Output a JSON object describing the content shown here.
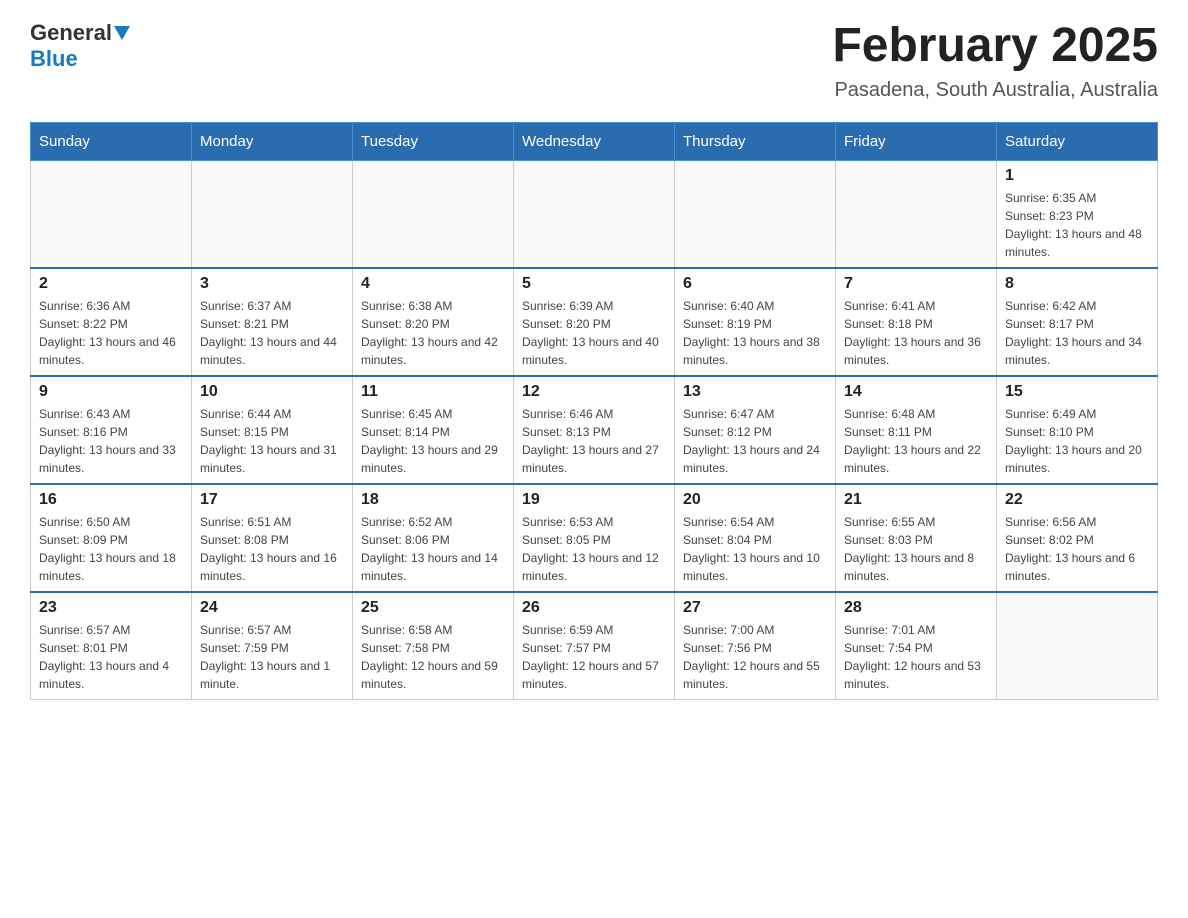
{
  "header": {
    "logo_general": "General",
    "logo_blue": "Blue",
    "title": "February 2025",
    "subtitle": "Pasadena, South Australia, Australia"
  },
  "days_of_week": [
    "Sunday",
    "Monday",
    "Tuesday",
    "Wednesday",
    "Thursday",
    "Friday",
    "Saturday"
  ],
  "weeks": [
    [
      {
        "day": "",
        "info": ""
      },
      {
        "day": "",
        "info": ""
      },
      {
        "day": "",
        "info": ""
      },
      {
        "day": "",
        "info": ""
      },
      {
        "day": "",
        "info": ""
      },
      {
        "day": "",
        "info": ""
      },
      {
        "day": "1",
        "info": "Sunrise: 6:35 AM\nSunset: 8:23 PM\nDaylight: 13 hours and 48 minutes."
      }
    ],
    [
      {
        "day": "2",
        "info": "Sunrise: 6:36 AM\nSunset: 8:22 PM\nDaylight: 13 hours and 46 minutes."
      },
      {
        "day": "3",
        "info": "Sunrise: 6:37 AM\nSunset: 8:21 PM\nDaylight: 13 hours and 44 minutes."
      },
      {
        "day": "4",
        "info": "Sunrise: 6:38 AM\nSunset: 8:20 PM\nDaylight: 13 hours and 42 minutes."
      },
      {
        "day": "5",
        "info": "Sunrise: 6:39 AM\nSunset: 8:20 PM\nDaylight: 13 hours and 40 minutes."
      },
      {
        "day": "6",
        "info": "Sunrise: 6:40 AM\nSunset: 8:19 PM\nDaylight: 13 hours and 38 minutes."
      },
      {
        "day": "7",
        "info": "Sunrise: 6:41 AM\nSunset: 8:18 PM\nDaylight: 13 hours and 36 minutes."
      },
      {
        "day": "8",
        "info": "Sunrise: 6:42 AM\nSunset: 8:17 PM\nDaylight: 13 hours and 34 minutes."
      }
    ],
    [
      {
        "day": "9",
        "info": "Sunrise: 6:43 AM\nSunset: 8:16 PM\nDaylight: 13 hours and 33 minutes."
      },
      {
        "day": "10",
        "info": "Sunrise: 6:44 AM\nSunset: 8:15 PM\nDaylight: 13 hours and 31 minutes."
      },
      {
        "day": "11",
        "info": "Sunrise: 6:45 AM\nSunset: 8:14 PM\nDaylight: 13 hours and 29 minutes."
      },
      {
        "day": "12",
        "info": "Sunrise: 6:46 AM\nSunset: 8:13 PM\nDaylight: 13 hours and 27 minutes."
      },
      {
        "day": "13",
        "info": "Sunrise: 6:47 AM\nSunset: 8:12 PM\nDaylight: 13 hours and 24 minutes."
      },
      {
        "day": "14",
        "info": "Sunrise: 6:48 AM\nSunset: 8:11 PM\nDaylight: 13 hours and 22 minutes."
      },
      {
        "day": "15",
        "info": "Sunrise: 6:49 AM\nSunset: 8:10 PM\nDaylight: 13 hours and 20 minutes."
      }
    ],
    [
      {
        "day": "16",
        "info": "Sunrise: 6:50 AM\nSunset: 8:09 PM\nDaylight: 13 hours and 18 minutes."
      },
      {
        "day": "17",
        "info": "Sunrise: 6:51 AM\nSunset: 8:08 PM\nDaylight: 13 hours and 16 minutes."
      },
      {
        "day": "18",
        "info": "Sunrise: 6:52 AM\nSunset: 8:06 PM\nDaylight: 13 hours and 14 minutes."
      },
      {
        "day": "19",
        "info": "Sunrise: 6:53 AM\nSunset: 8:05 PM\nDaylight: 13 hours and 12 minutes."
      },
      {
        "day": "20",
        "info": "Sunrise: 6:54 AM\nSunset: 8:04 PM\nDaylight: 13 hours and 10 minutes."
      },
      {
        "day": "21",
        "info": "Sunrise: 6:55 AM\nSunset: 8:03 PM\nDaylight: 13 hours and 8 minutes."
      },
      {
        "day": "22",
        "info": "Sunrise: 6:56 AM\nSunset: 8:02 PM\nDaylight: 13 hours and 6 minutes."
      }
    ],
    [
      {
        "day": "23",
        "info": "Sunrise: 6:57 AM\nSunset: 8:01 PM\nDaylight: 13 hours and 4 minutes."
      },
      {
        "day": "24",
        "info": "Sunrise: 6:57 AM\nSunset: 7:59 PM\nDaylight: 13 hours and 1 minute."
      },
      {
        "day": "25",
        "info": "Sunrise: 6:58 AM\nSunset: 7:58 PM\nDaylight: 12 hours and 59 minutes."
      },
      {
        "day": "26",
        "info": "Sunrise: 6:59 AM\nSunset: 7:57 PM\nDaylight: 12 hours and 57 minutes."
      },
      {
        "day": "27",
        "info": "Sunrise: 7:00 AM\nSunset: 7:56 PM\nDaylight: 12 hours and 55 minutes."
      },
      {
        "day": "28",
        "info": "Sunrise: 7:01 AM\nSunset: 7:54 PM\nDaylight: 12 hours and 53 minutes."
      },
      {
        "day": "",
        "info": ""
      }
    ]
  ]
}
